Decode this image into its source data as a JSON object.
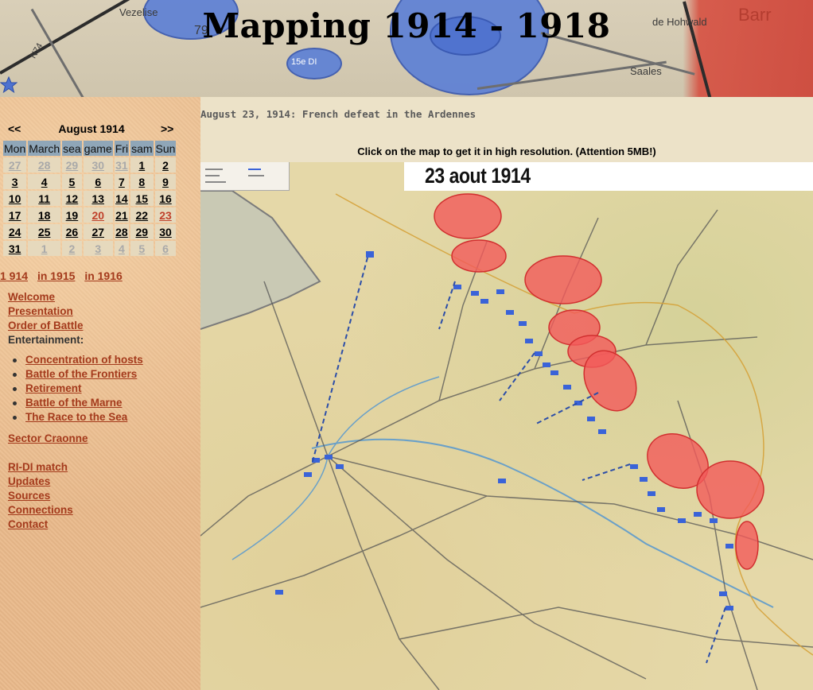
{
  "header": {
    "title": "Mapping 1914 - 1918",
    "banner_labels": [
      "Vezelise",
      "79",
      "15e DI",
      "de Hohwald",
      "Saales",
      "Barr",
      "N74"
    ]
  },
  "calendar": {
    "prev": "<<",
    "month": "August 1914",
    "next": ">>",
    "weekdays": [
      "Mon",
      "March",
      "sea",
      "game",
      "Fri",
      "sam",
      "Sun"
    ],
    "weeks": [
      [
        {
          "d": "27",
          "o": true
        },
        {
          "d": "28",
          "o": true
        },
        {
          "d": "29",
          "o": true
        },
        {
          "d": "30",
          "o": true
        },
        {
          "d": "31",
          "o": true
        },
        {
          "d": "1"
        },
        {
          "d": "2"
        }
      ],
      [
        {
          "d": "3"
        },
        {
          "d": "4"
        },
        {
          "d": "5"
        },
        {
          "d": "6"
        },
        {
          "d": "7"
        },
        {
          "d": "8"
        },
        {
          "d": "9"
        }
      ],
      [
        {
          "d": "10"
        },
        {
          "d": "11"
        },
        {
          "d": "12"
        },
        {
          "d": "13"
        },
        {
          "d": "14"
        },
        {
          "d": "15"
        },
        {
          "d": "16"
        }
      ],
      [
        {
          "d": "17"
        },
        {
          "d": "18"
        },
        {
          "d": "19"
        },
        {
          "d": "20",
          "h": true
        },
        {
          "d": "21"
        },
        {
          "d": "22"
        },
        {
          "d": "23",
          "h": true
        }
      ],
      [
        {
          "d": "24"
        },
        {
          "d": "25"
        },
        {
          "d": "26"
        },
        {
          "d": "27"
        },
        {
          "d": "28"
        },
        {
          "d": "29"
        },
        {
          "d": "30"
        }
      ],
      [
        {
          "d": "31"
        },
        {
          "d": "1",
          "o": true
        },
        {
          "d": "2",
          "o": true
        },
        {
          "d": "3",
          "o": true
        },
        {
          "d": "4",
          "o": true
        },
        {
          "d": "5",
          "o": true
        },
        {
          "d": "6",
          "o": true
        }
      ]
    ]
  },
  "years": [
    "1 914",
    "in 1915",
    "in 1916"
  ],
  "nav": {
    "welcome": "Welcome",
    "presentation": "Presentation",
    "order_of_battle": "Order of Battle",
    "entertainment": "Entertainment:",
    "sub": [
      "Concentration of hosts",
      "Battle of the Frontiers",
      "Retirement",
      "Battle of the Marne",
      "The Race to the Sea"
    ],
    "sector": "Sector Craonne",
    "ri_di": "RI-DI match",
    "updates": "Updates",
    "sources": "Sources",
    "connections": "Connections",
    "contact": "Contact"
  },
  "main": {
    "subtitle": "August 23, 1914: French defeat in the Ardennes",
    "hint": "Click on the map to get it in high resolution. (Attention 5MB!)",
    "map_title": "23 aout 1914"
  },
  "colors": {
    "link": "#a43a1c",
    "german_army": "#f25a5a",
    "french_army": "#3a63d8",
    "sidebar_bg": "#e9b98a",
    "calendar_header": "#8fa6b8"
  }
}
